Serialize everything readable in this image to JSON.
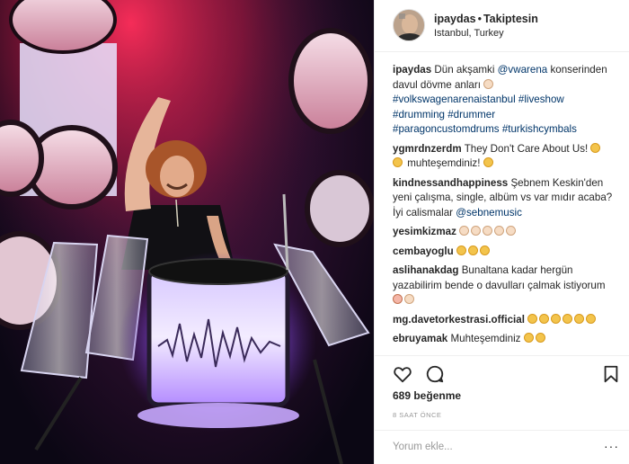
{
  "header": {
    "username": "ipaydas",
    "separator": "•",
    "follow_label": "Takiptesin",
    "location": "Istanbul, Turkey"
  },
  "caption": {
    "username": "ipaydas",
    "text_before": "Dün akşamki ",
    "mention": "@vwarena",
    "text_after": " konserinden davul dövme anları",
    "hashtags": [
      "#volkswagenarenaistanbul",
      "#liveshow",
      "#drumming",
      "#drummer",
      "#paragoncustomdrums",
      "#turkishcymbals"
    ]
  },
  "comments": [
    {
      "username": "ygmrdnzerdm",
      "text": "They Don't Care About Us!",
      "text2": "muhteşemdiniz!"
    },
    {
      "username": "kindnessandhappiness",
      "text": "Şebnem Keskin'den yeni çalışma, single, albüm vs var mıdır acaba? İyi calismalar ",
      "mention": "@sebnemusic"
    },
    {
      "username": "yesimkizmaz",
      "text": ""
    },
    {
      "username": "cembayoglu",
      "text": ""
    },
    {
      "username": "aslihanakdag",
      "text": "Bunaltana kadar hergün yazabilirim bende o davulları çalmak istiyorum"
    },
    {
      "username": "mg.davetorkestrasi.official",
      "text": ""
    },
    {
      "username": "ebruyamak",
      "text": "Muhteşemdiniz"
    }
  ],
  "icons": [
    "heart-icon",
    "comment-icon",
    "bookmark-icon",
    "more-icon"
  ],
  "likes": "689 beğenme",
  "timestamp": "8 SAAT ÖNCE",
  "comment_input": {
    "placeholder": "Yorum ekle...",
    "more": "···"
  },
  "colors": {
    "link": "#003569",
    "text": "#262626",
    "muted": "#999999",
    "stage_red": "#e0254a",
    "stage_purple": "#9a5cff"
  }
}
